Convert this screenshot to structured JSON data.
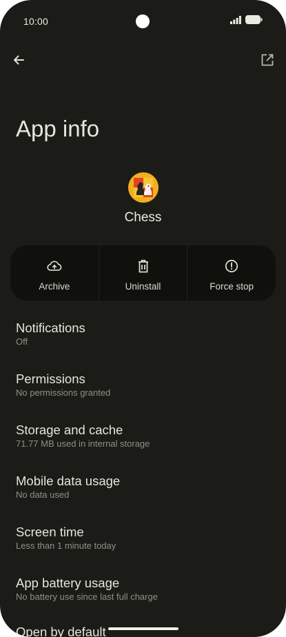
{
  "status_bar": {
    "time": "10:00"
  },
  "header": {
    "title": "App info"
  },
  "app": {
    "name": "Chess"
  },
  "actions": [
    {
      "label": "Archive",
      "icon": "cloud-upload-icon"
    },
    {
      "label": "Uninstall",
      "icon": "trash-icon"
    },
    {
      "label": "Force stop",
      "icon": "alert-circle-icon"
    }
  ],
  "settings": [
    {
      "title": "Notifications",
      "subtitle": "Off"
    },
    {
      "title": "Permissions",
      "subtitle": "No permissions granted"
    },
    {
      "title": "Storage and cache",
      "subtitle": "71.77 MB used in internal storage"
    },
    {
      "title": "Mobile data usage",
      "subtitle": "No data used"
    },
    {
      "title": "Screen time",
      "subtitle": "Less than 1 minute today"
    },
    {
      "title": "App battery usage",
      "subtitle": "No battery use since last full charge"
    },
    {
      "title": "Open by default",
      "subtitle": ""
    }
  ],
  "colors": {
    "background": "#1b1c17",
    "action_panel": "#10110d",
    "text_primary": "#e6e5da",
    "text_secondary": "#8f9086"
  }
}
